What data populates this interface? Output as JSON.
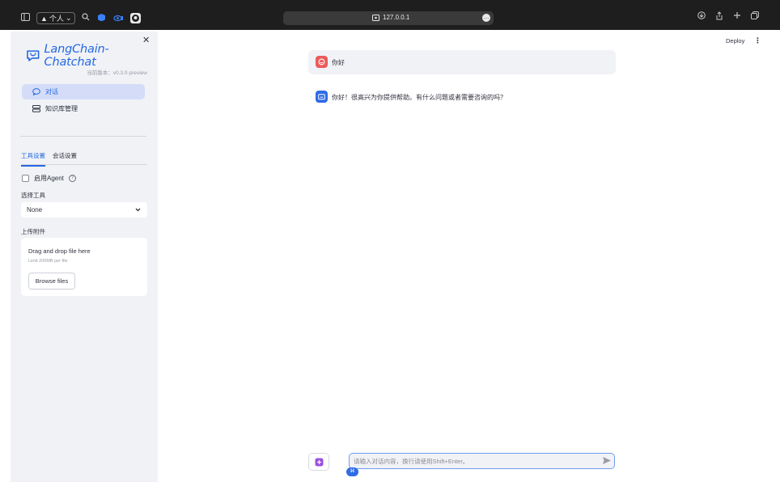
{
  "browser": {
    "profile_label": "个人",
    "url": "127.0.0.1",
    "colors": {
      "chrome_bg": "#1e1e1e"
    }
  },
  "sidebar": {
    "logo_text": "LangChain-Chatchat",
    "version": "当前版本：v0.3.0-preview",
    "nav": [
      {
        "label": "对话",
        "icon": "chat-bubble-icon",
        "active": true
      },
      {
        "label": "知识库管理",
        "icon": "database-icon",
        "active": false
      }
    ],
    "tabs": [
      {
        "label": "工具设置",
        "active": true
      },
      {
        "label": "会话设置",
        "active": false
      }
    ],
    "agent_label": "启用Agent",
    "select_tool_label": "选择工具",
    "select_tool_value": "None",
    "upload_label": "上传附件",
    "dropzone": {
      "title": "Drag and drop file here",
      "subtitle": "Limit 200MB per file",
      "button": "Browse files"
    }
  },
  "header": {
    "deploy_label": "Deploy"
  },
  "chat": {
    "messages": [
      {
        "role": "user",
        "text": "你好"
      },
      {
        "role": "assistant",
        "text": "你好！很高兴为你提供帮助。有什么问题或者需要咨询的吗？"
      }
    ],
    "input_placeholder": "请输入对话内容，换行请使用Shift+Enter。"
  },
  "colors": {
    "accent": "#2568e2",
    "sidebar_bg": "#f0f2f6",
    "user_avatar": "#ea5b5b",
    "assistant_avatar": "#2f6be6"
  }
}
